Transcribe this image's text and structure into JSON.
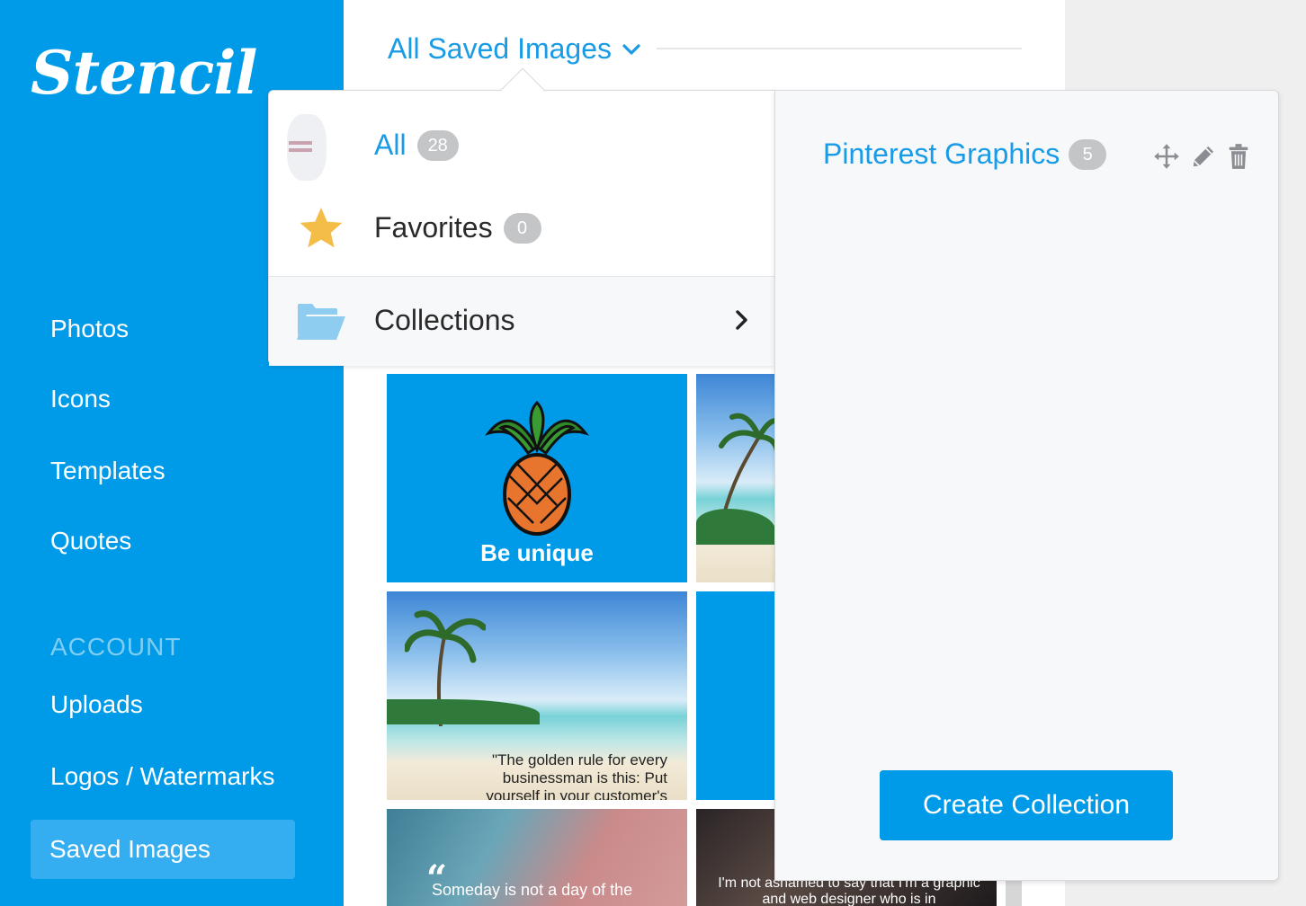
{
  "brand": {
    "logo_text": "Stencil"
  },
  "sidebar": {
    "items": [
      {
        "label": "Photos"
      },
      {
        "label": "Icons"
      },
      {
        "label": "Templates"
      },
      {
        "label": "Quotes"
      }
    ],
    "section_label": "ACCOUNT",
    "account_items": [
      {
        "label": "Uploads"
      },
      {
        "label": "Logos / Watermarks"
      },
      {
        "label": "Saved Images",
        "active": true
      }
    ]
  },
  "main": {
    "header_title": "All Saved Images",
    "thumbnails": [
      {
        "text": "Be unique"
      },
      {
        "text": ""
      },
      {
        "text": "\"The golden rule for every businessman is this: Put yourself in your customer's place\""
      },
      {
        "text": ""
      },
      {
        "text": "Someday is not a day of the"
      },
      {
        "text": "I'm not ashamed to say that I'm a graphic and web designer who is in"
      }
    ]
  },
  "dropdown": {
    "all": {
      "label": "All",
      "count": "28"
    },
    "favorites": {
      "label": "Favorites",
      "count": "0"
    },
    "collections": {
      "label": "Collections"
    },
    "collection_list": [
      {
        "name": "Pinterest Graphics",
        "count": "5"
      }
    ],
    "create_button": "Create Collection"
  },
  "icons": [
    "chevron-down-icon",
    "star-icon",
    "folder-open-icon",
    "chevron-right-icon",
    "move-icon",
    "pencil-icon",
    "trash-icon"
  ],
  "colors": {
    "brand_blue": "#009be8",
    "link_blue": "#1a9be6",
    "star": "#f3bd48",
    "folder": "#8ecdf0"
  }
}
